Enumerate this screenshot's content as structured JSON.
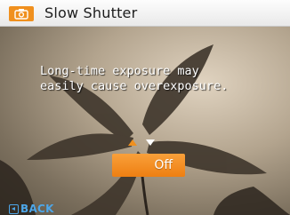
{
  "header": {
    "mode_icon": "camera-icon",
    "title": "Slow Shutter"
  },
  "message": "Long-time exposure may\neasily cause overexposure.",
  "selector": {
    "up_arrow_icon": "arrow-up-icon",
    "down_arrow_icon": "arrow-down-icon",
    "selected_value": "Off"
  },
  "footer": {
    "back_icon": "back-icon",
    "back_label": "BACK"
  },
  "colors": {
    "accent": "#f0901e",
    "back": "#4da6e8",
    "titlebar": "#f2f2f2"
  }
}
